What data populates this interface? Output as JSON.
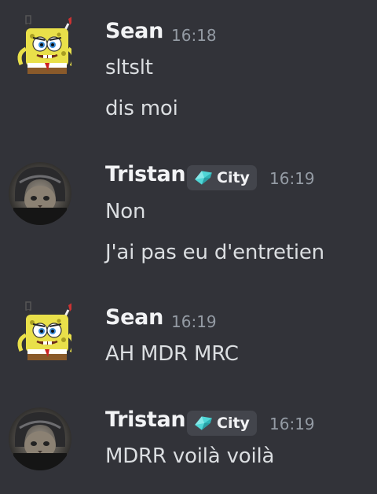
{
  "messages": [
    {
      "author": "Sean",
      "time": "16:18",
      "lines": [
        "sltslt",
        "dis moi"
      ],
      "avatar_icon": "spongebob-chef-avatar"
    },
    {
      "author": "Tristan",
      "time": "16:19",
      "tag": {
        "label": "City",
        "icon": "diamond-gem-icon",
        "color": "#4fd6d6"
      },
      "lines": [
        "Non",
        "J'ai pas eu d'entretien"
      ],
      "avatar_icon": "cat-helmet-avatar"
    },
    {
      "author": "Sean",
      "time": "16:19",
      "lines": [
        "AH MDR MRC"
      ],
      "avatar_icon": "spongebob-chef-avatar"
    },
    {
      "author": "Tristan",
      "time": "16:19",
      "tag": {
        "label": "City",
        "icon": "diamond-gem-icon",
        "color": "#4fd6d6"
      },
      "lines": [
        "MDRR voilà voilà"
      ],
      "avatar_icon": "cat-helmet-avatar"
    }
  ],
  "colors": {
    "background": "#323339",
    "author": "#f2f3f5",
    "timestamp": "#949ba4",
    "message_text": "#dbdee1",
    "tag_bg": "#43454c"
  }
}
